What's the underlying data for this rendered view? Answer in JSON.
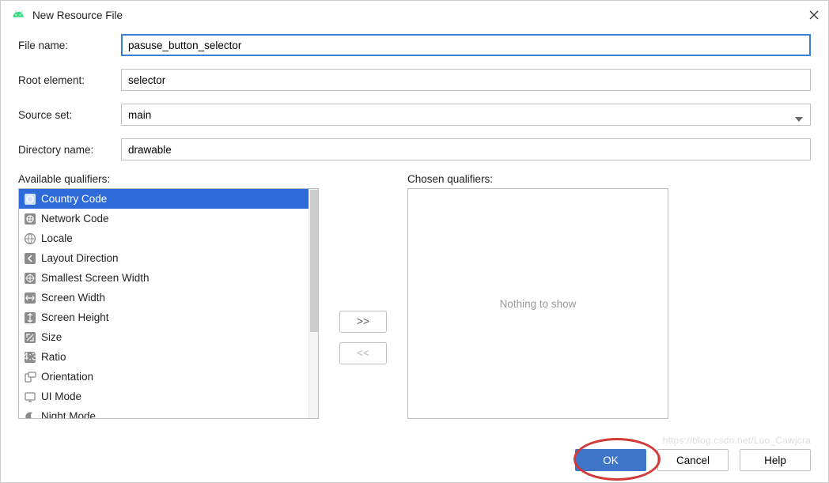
{
  "window": {
    "title": "New Resource File"
  },
  "form": {
    "file_name_label": "File name:",
    "file_name_value": "pasuse_button_selector",
    "root_element_label": "Root element:",
    "root_element_value": "selector",
    "source_set_label": "Source set:",
    "source_set_value": "main",
    "directory_name_label": "Directory name:",
    "directory_name_value": "drawable"
  },
  "qualifiers": {
    "available_label": "Available qualifiers:",
    "chosen_label": "Chosen qualifiers:",
    "chosen_empty_text": "Nothing to show",
    "items": [
      {
        "label": "Country Code",
        "icon": "globe-flag-icon",
        "selected": true
      },
      {
        "label": "Network Code",
        "icon": "network-icon",
        "selected": false
      },
      {
        "label": "Locale",
        "icon": "globe-icon",
        "selected": false
      },
      {
        "label": "Layout Direction",
        "icon": "arrow-left-icon",
        "selected": false
      },
      {
        "label": "Smallest Screen Width",
        "icon": "arrows-both-icon",
        "selected": false
      },
      {
        "label": "Screen Width",
        "icon": "arrows-h-icon",
        "selected": false
      },
      {
        "label": "Screen Height",
        "icon": "arrows-v-icon",
        "selected": false
      },
      {
        "label": "Size",
        "icon": "resize-icon",
        "selected": false
      },
      {
        "label": "Ratio",
        "icon": "ratio-icon",
        "selected": false
      },
      {
        "label": "Orientation",
        "icon": "orientation-icon",
        "selected": false
      },
      {
        "label": "UI Mode",
        "icon": "uimode-icon",
        "selected": false
      },
      {
        "label": "Night Mode",
        "icon": "night-icon",
        "selected": false
      }
    ],
    "add_label": ">>",
    "remove_label": "<<"
  },
  "footer": {
    "ok_label": "OK",
    "cancel_label": "Cancel",
    "help_label": "Help"
  }
}
